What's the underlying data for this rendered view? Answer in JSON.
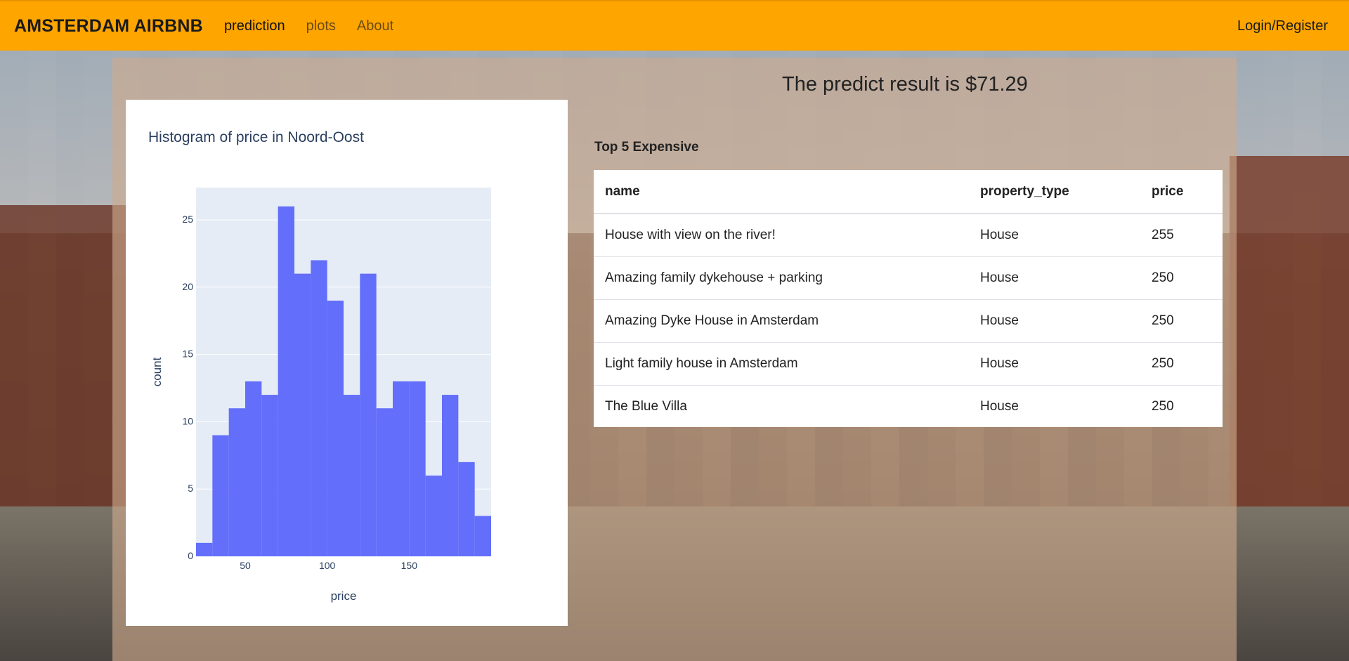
{
  "navbar": {
    "brand": "AMSTERDAM AIRBNB",
    "links": [
      "prediction",
      "plots",
      "About"
    ],
    "login": "Login/Register",
    "color": "#ffa500"
  },
  "result": {
    "text": "The predict result is $71.29"
  },
  "table": {
    "label": "Top 5 Expensive",
    "headers": [
      "name",
      "property_type",
      "price"
    ],
    "rows": [
      [
        "House with view on the river!",
        "House",
        "255"
      ],
      [
        "Amazing family dykehouse + parking",
        "House",
        "250"
      ],
      [
        "Amazing Dyke House in Amsterdam",
        "House",
        "250"
      ],
      [
        "Light family house in Amsterdam",
        "House",
        "250"
      ],
      [
        "The Blue Villa",
        "House",
        "250"
      ]
    ]
  },
  "chart_data": {
    "type": "bar",
    "title": "Histogram of price in Noord-Oost",
    "xlabel": "price",
    "ylabel": "count",
    "bin_start": 20,
    "bin_width": 10,
    "values": [
      1,
      9,
      11,
      13,
      12,
      26,
      21,
      22,
      19,
      12,
      21,
      11,
      13,
      13,
      6,
      12,
      7,
      3
    ],
    "xticks": [
      50,
      100,
      150
    ],
    "yticks": [
      0,
      5,
      10,
      15,
      20,
      25
    ],
    "xlim": [
      20,
      200
    ],
    "ylim": [
      0,
      27.4
    ],
    "bar_color": "#636efa",
    "plot_bg": "#e5ecf6",
    "grid": true
  }
}
